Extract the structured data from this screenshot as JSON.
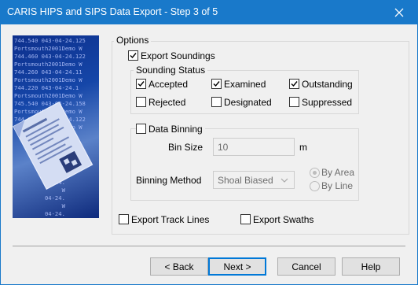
{
  "window": {
    "title": "CARIS HIPS and SIPS Data Export - Step 3 of 5"
  },
  "banner": {
    "lines": [
      "744.540 043-04-24.125",
      "Portsmouth2001Demo W",
      "744.460 043-04-24.122",
      "Portsmouth2001Demo W",
      "744.260 043-04-24.11",
      "Portsmouth2001Demo W",
      "744.220 043-04-24.1",
      "Portsmouth2001Demo W",
      "745.540 043-04-24.158",
      "Portsmouth2001Demo W",
      "744.180 043-04-24.122",
      "Portsmouth2001Demo W",
      "         04-24.1",
      "              W",
      "         04-24.12",
      "              W",
      "         04-24.11",
      "              W",
      "         04-24.",
      "              W",
      "         04-24.",
      "              W",
      "         04-24."
    ]
  },
  "options": {
    "label": "Options",
    "export_soundings": {
      "label": "Export Soundings",
      "checked": true
    },
    "sounding_status": {
      "label": "Sounding Status",
      "accepted": {
        "label": "Accepted",
        "checked": true
      },
      "examined": {
        "label": "Examined",
        "checked": true
      },
      "outstanding": {
        "label": "Outstanding",
        "checked": true
      },
      "rejected": {
        "label": "Rejected",
        "checked": false
      },
      "designated": {
        "label": "Designated",
        "checked": false
      },
      "suppressed": {
        "label": "Suppressed",
        "checked": false
      }
    },
    "data_binning": {
      "label": "Data Binning",
      "checked": false,
      "bin_size_label": "Bin Size",
      "bin_size_value": "10",
      "bin_size_unit": "m",
      "binning_method_label": "Binning Method",
      "binning_method_value": "Shoal Biased",
      "by_area_label": "By Area",
      "by_line_label": "By Line",
      "by_area_selected": true
    },
    "export_track_lines": {
      "label": "Export Track Lines",
      "checked": false
    },
    "export_swaths": {
      "label": "Export Swaths",
      "checked": false
    }
  },
  "buttons": {
    "back": "< Back",
    "next": "Next >",
    "cancel": "Cancel",
    "help": "Help"
  },
  "colors": {
    "titlebar": "#1979ca",
    "dialog_bg": "#f0f0f0",
    "default_button_border": "#0078d7"
  }
}
